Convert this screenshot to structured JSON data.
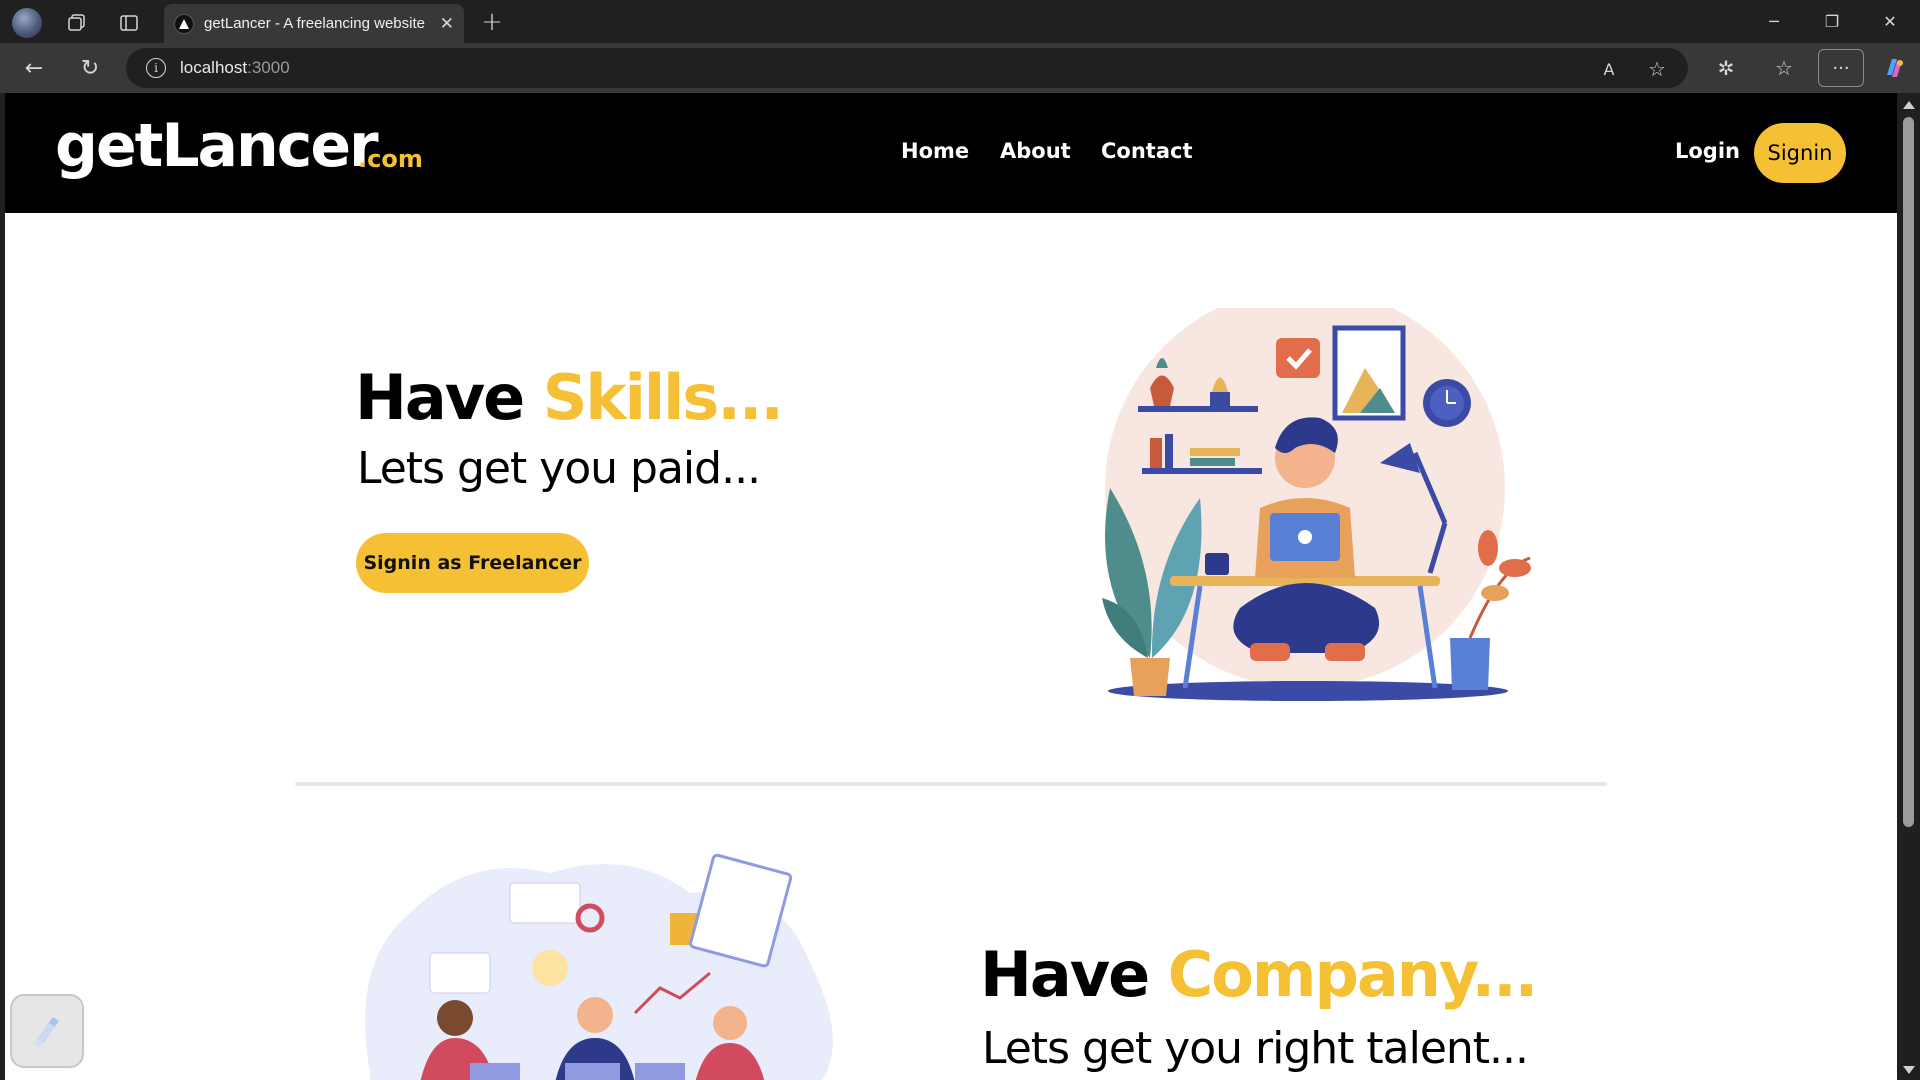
{
  "browser": {
    "tab_title": "getLancer - A freelancing website",
    "url_host": "localhost",
    "url_port": ":3000"
  },
  "navbar": {
    "logo_text": "getLancer",
    "logo_suffix": ".com",
    "links": [
      "Home",
      "About",
      "Contact"
    ],
    "login_label": "Login",
    "signin_label": "Signin"
  },
  "hero": {
    "headline_prefix": "Have ",
    "headline_accent": "Skills...",
    "subheadline": "Lets get you paid...",
    "cta_label": "Signin as Freelancer"
  },
  "company": {
    "headline_prefix": "Have ",
    "headline_accent": "Company...",
    "subheadline": "Lets get you right talent..."
  },
  "colors": {
    "accent": "#f5c033",
    "navbar_bg": "#000000",
    "page_bg": "#ffffff"
  }
}
